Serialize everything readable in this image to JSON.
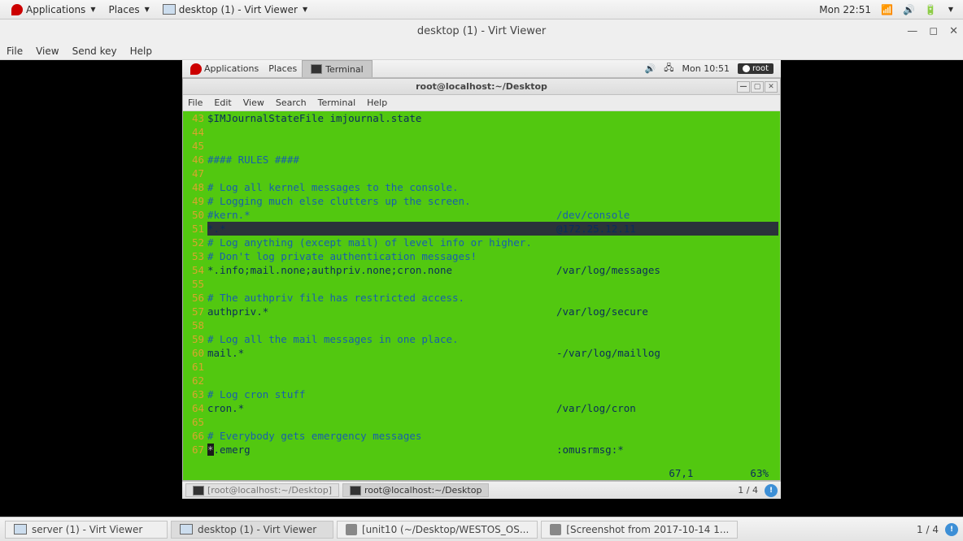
{
  "outer_top": {
    "applications": "Applications",
    "places": "Places",
    "active_app": "desktop (1) - Virt Viewer",
    "clock": "Mon 22:51"
  },
  "viewer": {
    "title": "desktop (1) - Virt Viewer",
    "menu": {
      "file": "File",
      "view": "View",
      "send_key": "Send key",
      "help": "Help"
    }
  },
  "guest_top": {
    "applications": "Applications",
    "places": "Places",
    "active_app": "Terminal",
    "clock": "Mon 10:51",
    "user": "root"
  },
  "terminal": {
    "title": "root@localhost:~/Desktop",
    "menu": {
      "file": "File",
      "edit": "Edit",
      "view": "View",
      "search": "Search",
      "terminal": "Terminal",
      "help": "Help"
    },
    "status_pos": "67,1",
    "status_pct": "63%",
    "lines": [
      {
        "n": "43",
        "text": "$IMJournalStateFile imjournal.state",
        "cls": "code-text"
      },
      {
        "n": "44",
        "text": "",
        "cls": "code-text"
      },
      {
        "n": "45",
        "text": "",
        "cls": "code-text"
      },
      {
        "n": "46",
        "text": "#### RULES ####",
        "cls": "comment"
      },
      {
        "n": "47",
        "text": "",
        "cls": "code-text"
      },
      {
        "n": "48",
        "text": "# Log all kernel messages to the console.",
        "cls": "comment"
      },
      {
        "n": "49",
        "text": "# Logging much else clutters up the screen.",
        "cls": "comment"
      },
      {
        "n": "50",
        "left": "#kern.*",
        "right": "/dev/console",
        "cls": "comment",
        "split": true
      },
      {
        "n": "51",
        "left": "*.*",
        "right": "@172.25.12.11",
        "cls": "code-text",
        "split": true,
        "hl": true
      },
      {
        "n": "52",
        "text": "# Log anything (except mail) of level info or higher.",
        "cls": "comment"
      },
      {
        "n": "53",
        "text": "# Don't log private authentication messages!",
        "cls": "comment"
      },
      {
        "n": "54",
        "left": "*.info;mail.none;authpriv.none;cron.none",
        "right": "/var/log/messages",
        "cls": "code-text",
        "split": true
      },
      {
        "n": "55",
        "text": "",
        "cls": "code-text"
      },
      {
        "n": "56",
        "text": "# The authpriv file has restricted access.",
        "cls": "comment"
      },
      {
        "n": "57",
        "left": "authpriv.*",
        "right": "/var/log/secure",
        "cls": "code-text",
        "split": true
      },
      {
        "n": "58",
        "text": "",
        "cls": "code-text"
      },
      {
        "n": "59",
        "text": "# Log all the mail messages in one place.",
        "cls": "comment"
      },
      {
        "n": "60",
        "left": "mail.*",
        "right": "-/var/log/maillog",
        "cls": "code-text",
        "split": true
      },
      {
        "n": "61",
        "text": "",
        "cls": "code-text"
      },
      {
        "n": "62",
        "text": "",
        "cls": "code-text"
      },
      {
        "n": "63",
        "text": "# Log cron stuff",
        "cls": "comment"
      },
      {
        "n": "64",
        "left": "cron.*",
        "right": "/var/log/cron",
        "cls": "code-text",
        "split": true
      },
      {
        "n": "65",
        "text": "",
        "cls": "code-text"
      },
      {
        "n": "66",
        "text": "# Everybody gets emergency messages",
        "cls": "comment"
      },
      {
        "n": "67",
        "left": ".emerg",
        "right": ":omusrmsg:*",
        "cls": "code-text",
        "split": true,
        "cursor": true
      }
    ]
  },
  "guest_bottom": {
    "task1": "[root@localhost:~/Desktop]",
    "task2": "root@localhost:~/Desktop",
    "ws": "1 / 4"
  },
  "outer_bottom": {
    "task1": "server (1) - Virt Viewer",
    "task2": "desktop (1) - Virt Viewer",
    "task3": "[unit10 (~/Desktop/WESTOS_OS...",
    "task4": "[Screenshot from 2017-10-14 1...",
    "ws": "1 / 4"
  }
}
